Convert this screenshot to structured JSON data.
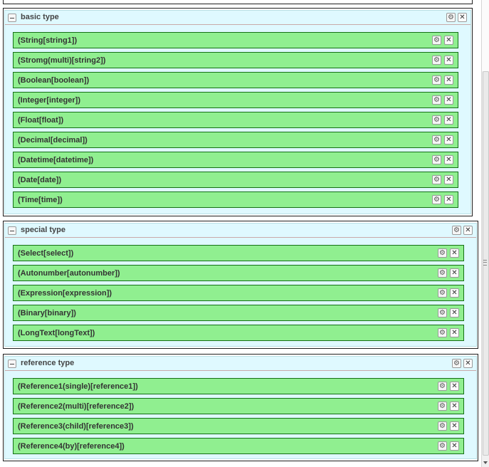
{
  "icons": {
    "collapse": "minus-icon",
    "settings": "gear-icon",
    "close": "close-icon"
  },
  "glyphs": {
    "gear": "⚙",
    "close": "✕"
  },
  "colors": {
    "row_fill": "#90ef90",
    "row_border": "#157015",
    "panel_fill": "#dff9ff"
  },
  "panels": [
    {
      "title": "basic type",
      "fields": [
        "(String[string1])",
        "(Stromg(multi)[string2])",
        "(Boolean[boolean])",
        "(Integer[integer])",
        "(Float[float])",
        "(Decimal[decimal])",
        "(Datetime[datetime])",
        "(Date[date])",
        "(Time[time])"
      ]
    },
    {
      "title": "special type",
      "fields": [
        "(Select[select])",
        "(Autonumber[autonumber])",
        "(Expression[expression])",
        "(Binary[binary])",
        "(LongText[longText])"
      ]
    },
    {
      "title": "reference type",
      "fields": [
        "(Reference1(single)[reference1])",
        "(Reference2(multi)[reference2])",
        "(Reference3(child)[reference3])",
        "(Reference4(by)[reference4])"
      ]
    }
  ]
}
